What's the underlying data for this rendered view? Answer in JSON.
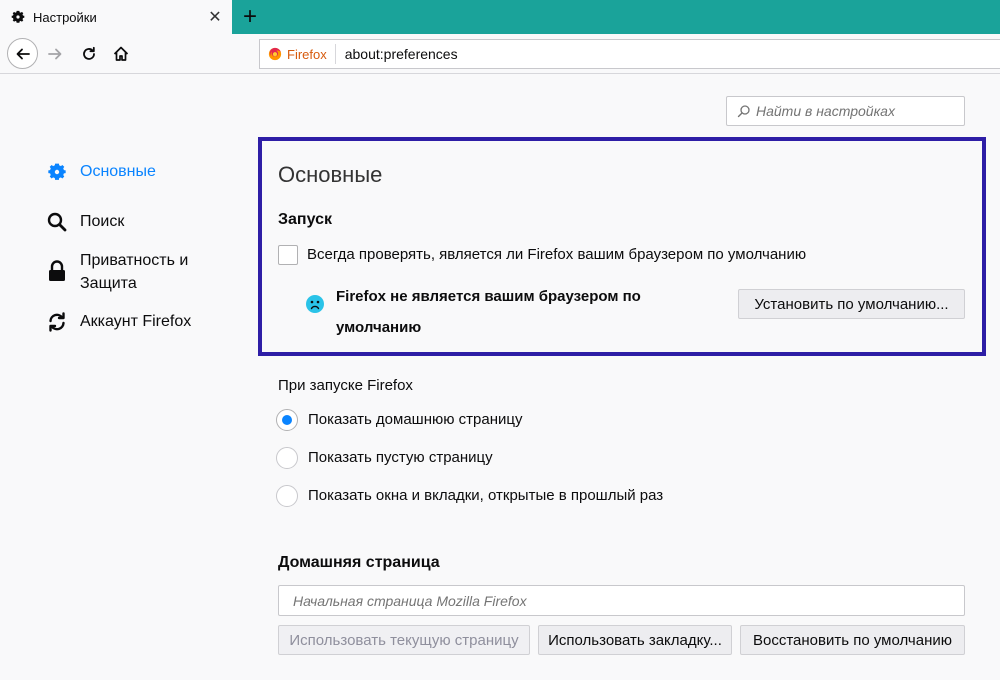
{
  "tab": {
    "title": "Настройки",
    "close_glyph": "✕"
  },
  "newtab_glyph": "+",
  "navbar": {
    "identity_label": "Firefox",
    "url": "about:preferences"
  },
  "search": {
    "placeholder": "Найти в настройках"
  },
  "sidebar": {
    "items": [
      {
        "label": "Основные",
        "icon": "gear-icon",
        "active": true
      },
      {
        "label": "Поиск",
        "icon": "search-icon"
      },
      {
        "label_line1": "Приватность и",
        "label_line2": "Защита",
        "icon": "lock-icon"
      },
      {
        "label": "Аккаунт Firefox",
        "icon": "sync-icon"
      }
    ]
  },
  "general": {
    "title": "Основные",
    "startup_heading": "Запуск",
    "check_default_label": "Всегда проверять, является ли Firefox вашим браузером по умолчанию",
    "check_default_checked": false,
    "not_default_line1": "Firefox не является вашим браузером по",
    "not_default_line2": "умолчанию",
    "set_default_button": "Установить по умолчанию..."
  },
  "startup": {
    "label": "При запуске Firefox",
    "options": [
      {
        "label": "Показать домашнюю страницу",
        "checked": true
      },
      {
        "label": "Показать пустую страницу",
        "checked": false
      },
      {
        "label": "Показать окна и вкладки, открытые в прошлый раз",
        "checked": false
      }
    ]
  },
  "home": {
    "heading": "Домашняя страница",
    "input_placeholder": "Начальная страница Mozilla Firefox",
    "use_current_button": "Использовать текущую страницу",
    "use_bookmark_button": "Использовать закладку...",
    "restore_button": "Восстановить по умолчанию"
  },
  "colors": {
    "tabstrip": "#1aa39a",
    "accent": "#0a84ff",
    "highlight_border": "#2e1ea6"
  }
}
